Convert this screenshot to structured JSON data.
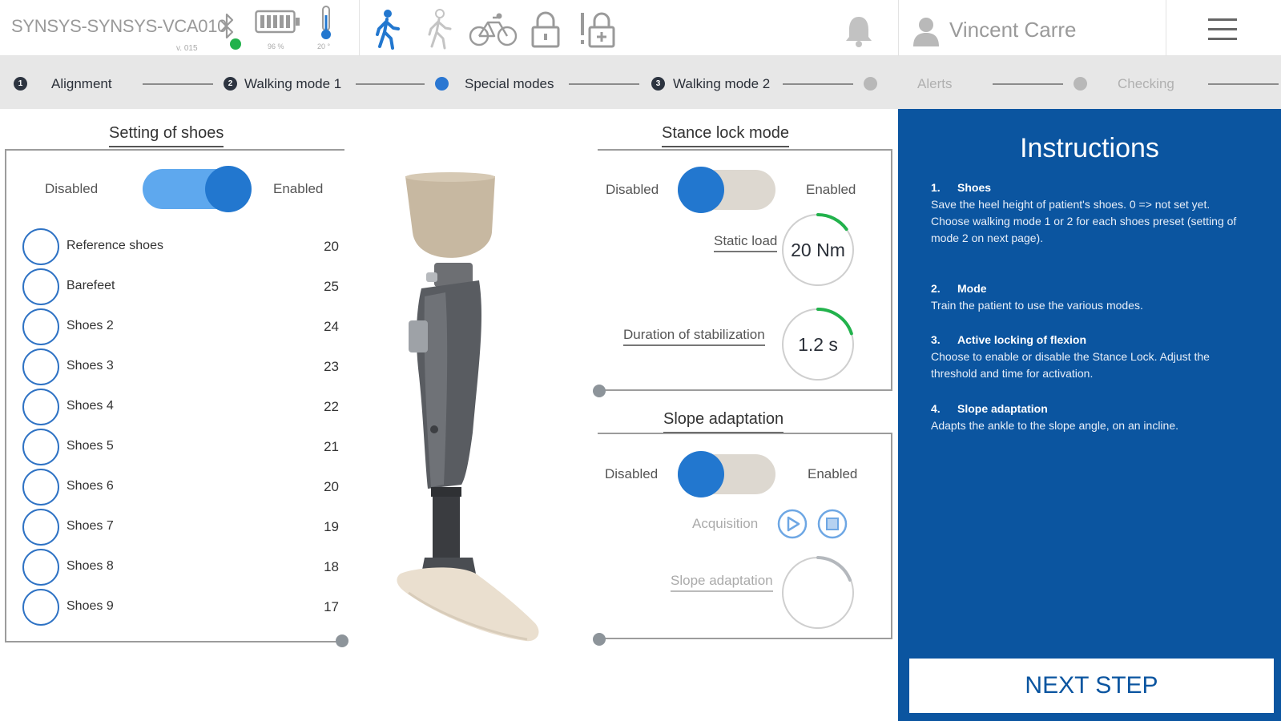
{
  "header": {
    "device_name": "SYNSYS-SYNSYS-VCA010",
    "device_sub": "v. 015",
    "battery_pct": "96 %",
    "temperature": "20 °",
    "user_name": "Vincent Carre",
    "colors": {
      "accent": "#2277cf",
      "inactive": "#9a9a9a",
      "bt_ok": "#22b24c"
    }
  },
  "steps": [
    {
      "num": "1",
      "label": "Alignment",
      "state": "done"
    },
    {
      "num": "2",
      "label": "Walking mode 1",
      "state": "done"
    },
    {
      "num": "",
      "label": "Special modes",
      "state": "active"
    },
    {
      "num": "3",
      "label": "Walking mode 2",
      "state": "done"
    },
    {
      "num": "",
      "label": "Alerts",
      "state": "future"
    },
    {
      "num": "",
      "label": "Checking",
      "state": "future"
    }
  ],
  "shoes": {
    "title": "Setting of shoes",
    "disabled_label": "Disabled",
    "enabled_label": "Enabled",
    "enabled": true,
    "items": [
      {
        "name": "Reference shoes",
        "value": "20"
      },
      {
        "name": "Barefeet",
        "value": "25"
      },
      {
        "name": "Shoes 2",
        "value": "24"
      },
      {
        "name": "Shoes 3",
        "value": "23"
      },
      {
        "name": "Shoes 4",
        "value": "22"
      },
      {
        "name": "Shoes 5",
        "value": "21"
      },
      {
        "name": "Shoes 6",
        "value": "20"
      },
      {
        "name": "Shoes 7",
        "value": "19"
      },
      {
        "name": "Shoes 8",
        "value": "18"
      },
      {
        "name": "Shoes 9",
        "value": "17"
      }
    ]
  },
  "stance": {
    "title": "Stance lock mode",
    "disabled_label": "Disabled",
    "enabled_label": "Enabled",
    "enabled": false,
    "static_load_label": "Static load",
    "static_load_value": "20 Nm",
    "static_load_fraction": 0.15,
    "duration_label": "Duration of stabilization",
    "duration_value": "1.2 s",
    "duration_fraction": 0.2
  },
  "slope": {
    "title": "Slope adaptation",
    "disabled_label": "Disabled",
    "enabled_label": "Enabled",
    "enabled": false,
    "acquisition_label": "Acquisition",
    "adaptation_label": "Slope adaptation"
  },
  "instructions": {
    "title": "Instructions",
    "items": [
      {
        "num": "1.",
        "head": "Shoes",
        "text": "Save the heel height of patient's shoes. 0 => not set yet.\nChoose walking mode 1 or 2 for each shoes preset (setting of mode 2 on next page)."
      },
      {
        "num": "2.",
        "head": "Mode",
        "text": "Train the patient to use the various modes."
      },
      {
        "num": "3.",
        "head": "Active locking of flexion",
        "text": "Choose to enable or disable the Stance Lock. Adjust the threshold and time for activation."
      },
      {
        "num": "4.",
        "head": "Slope adaptation",
        "text": "Adapts the ankle to the slope angle, on an incline."
      }
    ],
    "next_label": "NEXT STEP"
  }
}
